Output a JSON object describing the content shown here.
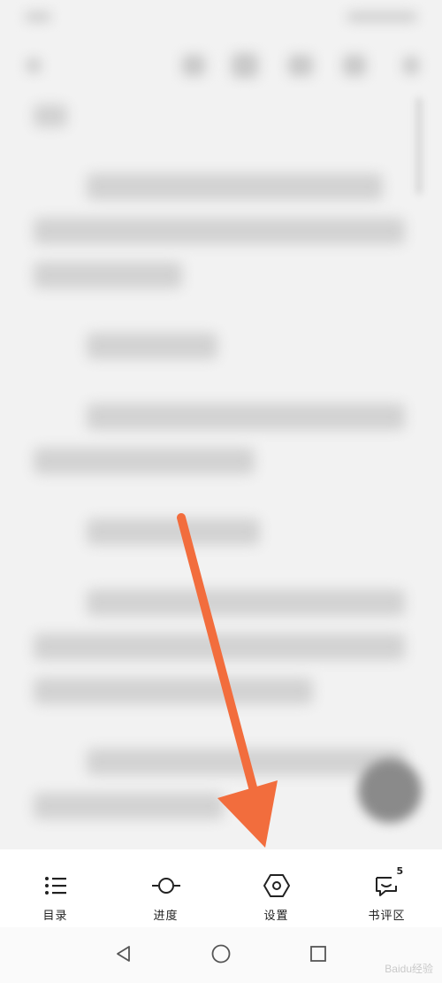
{
  "toolbar": {
    "items": [
      {
        "label": "目录",
        "icon": "list-icon"
      },
      {
        "label": "进度",
        "icon": "progress-icon"
      },
      {
        "label": "设置",
        "icon": "settings-hexagon-icon"
      },
      {
        "label": "书评区",
        "icon": "comments-icon",
        "badge": "5"
      }
    ]
  },
  "system_nav": {
    "back_icon": "back-triangle-icon",
    "home_icon": "home-circle-icon",
    "recents_icon": "recents-square-icon"
  },
  "watermark": {
    "text": "Baidu经验"
  },
  "colors": {
    "annotation_arrow": "#f26d3d",
    "toolbar_bg": "#ffffff",
    "page_bg": "#f2f2f2"
  }
}
